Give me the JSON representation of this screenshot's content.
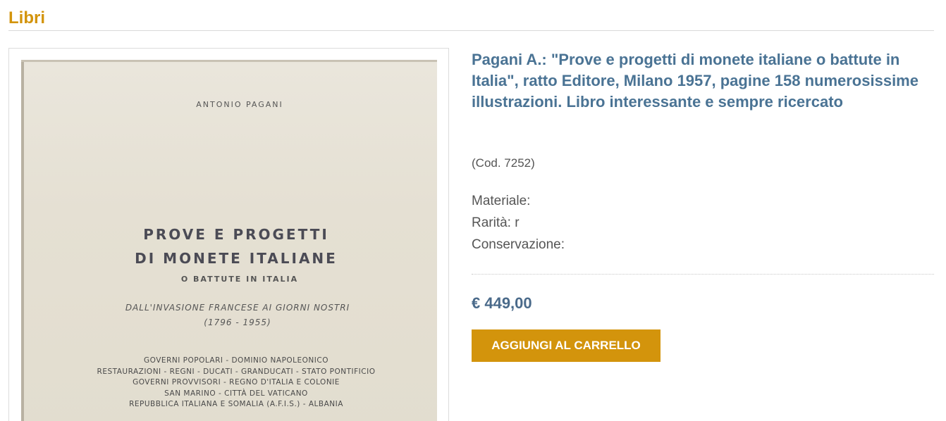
{
  "section": {
    "title": "Libri"
  },
  "cover": {
    "author": "ANTONIO PAGANI",
    "title_line1": "PROVE E PROGETTI",
    "title_line2": "DI MONETE ITALIANE",
    "subtitle": "O BATTUTE IN ITALIA",
    "period": "DALL'INVASIONE FRANCESE AI GIORNI NOSTRI",
    "years": "(1796 - 1955)",
    "list": [
      "GOVERNI POPOLARI - DOMINIO NAPOLEONICO",
      "RESTAURAZIONI - REGNI - DUCATI - GRANDUCATI - STATO PONTIFICIO",
      "GOVERNI PROVVISORI - REGNO D'ITALIA E COLONIE",
      "SAN MARINO - CITTÀ DEL VATICANO",
      "REPUBBLICA ITALIANA E SOMALIA (A.F.I.S.) - ALBANIA"
    ]
  },
  "product": {
    "title": "Pagani A.: \"Prove e progetti di monete italiane o battute in Italia\", ratto Editore, Milano 1957, pagine 158 numerosissime illustrazioni. Libro interessante e sempre ricercato",
    "code": "(Cod. 7252)",
    "materiale": "Materiale:",
    "rarita": "Rarità: r",
    "conservazione": "Conservazione:",
    "price": "€ 449,00",
    "cart_label": "AGGIUNGI AL CARRELLO"
  }
}
